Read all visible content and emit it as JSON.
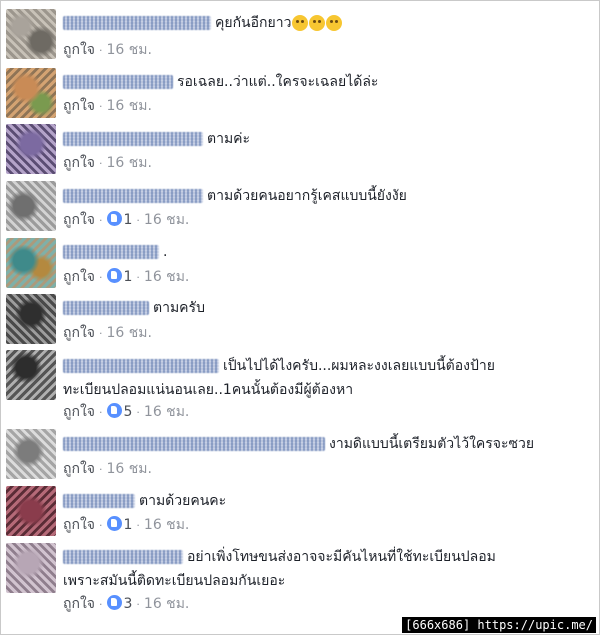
{
  "comments": [
    {
      "text": "คุยกันอีกยาว",
      "like": "ถูกใจ",
      "time": "16 ชม.",
      "reactions": null
    },
    {
      "text": "รอเฉลย..ว่าแต่..ใครจะเฉลยได้ล่ะ",
      "like": "ถูกใจ",
      "time": "16 ชม.",
      "reactions": null
    },
    {
      "text": "ตามค่ะ",
      "like": "ถูกใจ",
      "time": "16 ชม.",
      "reactions": null
    },
    {
      "text": "ตามด้วยคนอยากรู้เคสแบบนี้ยังงัย",
      "like": "ถูกใจ",
      "time": "16 ชม.",
      "reactions": "1"
    },
    {
      "text": ".",
      "like": "ถูกใจ",
      "time": "16 ชม.",
      "reactions": "1"
    },
    {
      "text": "ตามครับ",
      "like": "ถูกใจ",
      "time": "16 ชม.",
      "reactions": null
    },
    {
      "text": "เป็นไปได้ไงครับ...ผมหละงงเลยแบบนี้ต้องป้าย",
      "text2": "ทะเบียนปลอมแน่นอนเลย..1คนนั้นต้องมีผู้ต้องหา",
      "like": "ถูกใจ",
      "time": "16 ชม.",
      "reactions": "5"
    },
    {
      "text": "งามดิแบบนี้เตรียมตัวไว้ใครจะซวย",
      "like": "ถูกใจ",
      "time": "16 ชม.",
      "reactions": null
    },
    {
      "text": "ตามด้วยคนคะ",
      "like": "ถูกใจ",
      "time": "16 ชม.",
      "reactions": "1"
    },
    {
      "text": "อย่าเพิ่งโทษขนส่งอาจจะมีคันไหนที่ใช้ทะเบียนปลอม",
      "text2": "เพราะสมันนี้ติดทะเบียนปลอมกันเยอะ",
      "like": "ถูกใจ",
      "time": "16 ชม.",
      "reactions": "3"
    }
  ],
  "watermark": "[666x686] https://upic.me/",
  "colors": {
    "text": "#1d2129",
    "meta": "#90949c",
    "like_badge": "#5890ff"
  },
  "icons": {
    "reaction": "like-thumb-icon",
    "emoji": "smile-emoji-icon"
  }
}
